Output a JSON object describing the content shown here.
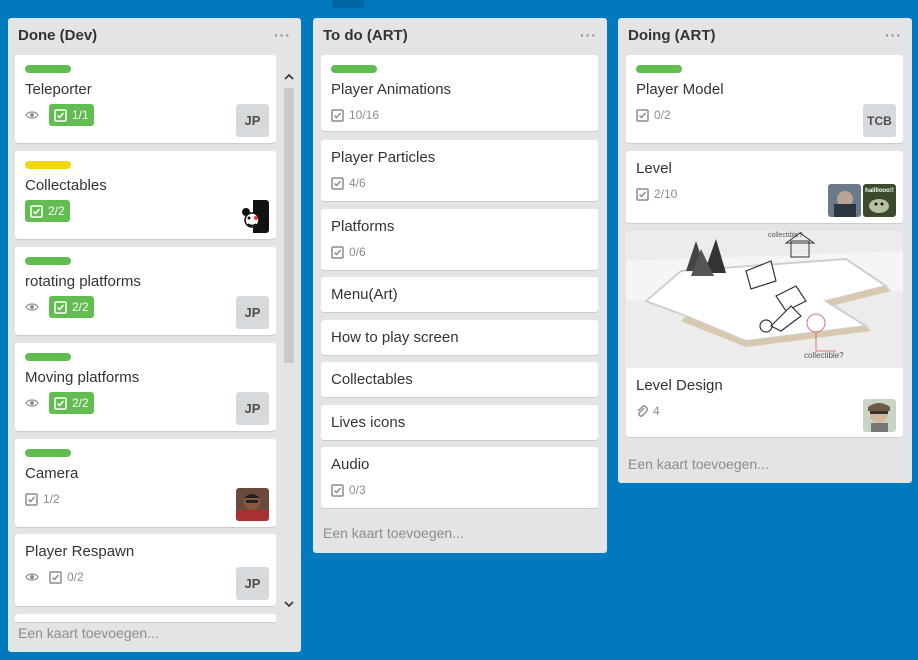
{
  "lists": [
    {
      "title": "Done (Dev)",
      "menu": "···",
      "add_card": "Een kaart toevoegen...",
      "cards": [
        {
          "title": "Teleporter",
          "checklist": "1/1",
          "member": "JP"
        },
        {
          "title": "Collectables",
          "checklist": "2/2"
        },
        {
          "title": "rotating platforms",
          "checklist": "2/2",
          "member": "JP"
        },
        {
          "title": "Moving platforms",
          "checklist": "2/2",
          "member": "JP"
        },
        {
          "title": "Camera",
          "checklist": "1/2"
        },
        {
          "title": "Player Respawn",
          "checklist": "0/2",
          "member": "JP"
        }
      ]
    },
    {
      "title": "To do (ART)",
      "menu": "···",
      "add_card": "Een kaart toevoegen...",
      "cards": [
        {
          "title": "Player Animations",
          "checklist": "10/16"
        },
        {
          "title": "Player Particles",
          "checklist": "4/6"
        },
        {
          "title": "Platforms",
          "checklist": "0/6"
        },
        {
          "title": "Menu(Art)"
        },
        {
          "title": "How to play screen"
        },
        {
          "title": "Collectables"
        },
        {
          "title": "Lives icons"
        },
        {
          "title": "Audio",
          "checklist": "0/3"
        }
      ]
    },
    {
      "title": "Doing (ART)",
      "menu": "···",
      "add_card": "Een kaart toevoegen...",
      "cards": [
        {
          "title": "Player Model",
          "checklist": "0/2",
          "member": "TCB"
        },
        {
          "title": "Level",
          "checklist": "2/10",
          "avatar_text": "hallllooo!!"
        },
        {
          "title": "Level Design",
          "attachments": "4",
          "cover_text_1": "collectible?",
          "cover_text_2": "collectible?"
        }
      ]
    }
  ],
  "colors": {
    "board_bg": "#0079bf",
    "list_bg": "#e2e4e6",
    "label_green": "#61bd4f",
    "label_yellow": "#f2d600"
  }
}
